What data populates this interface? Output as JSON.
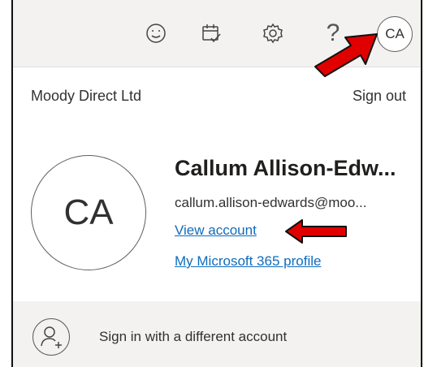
{
  "header": {
    "icons": [
      "smiley-icon",
      "calendar-check-icon",
      "gear-icon",
      "help-icon"
    ],
    "help_glyph": "?",
    "avatar_initials": "CA"
  },
  "account": {
    "organization": "Moody Direct Ltd",
    "sign_out_label": "Sign out",
    "initials": "CA",
    "name": "Callum Allison-Edw...",
    "email": "callum.allison-edwards@moo...",
    "view_account_label": "View account",
    "profile_label": "My Microsoft 365 profile"
  },
  "footer": {
    "different_account_label": "Sign in with a different account"
  },
  "colors": {
    "link": "#0f6cbd",
    "arrow": "#e00000",
    "topbar_bg": "#f3f2f1"
  }
}
